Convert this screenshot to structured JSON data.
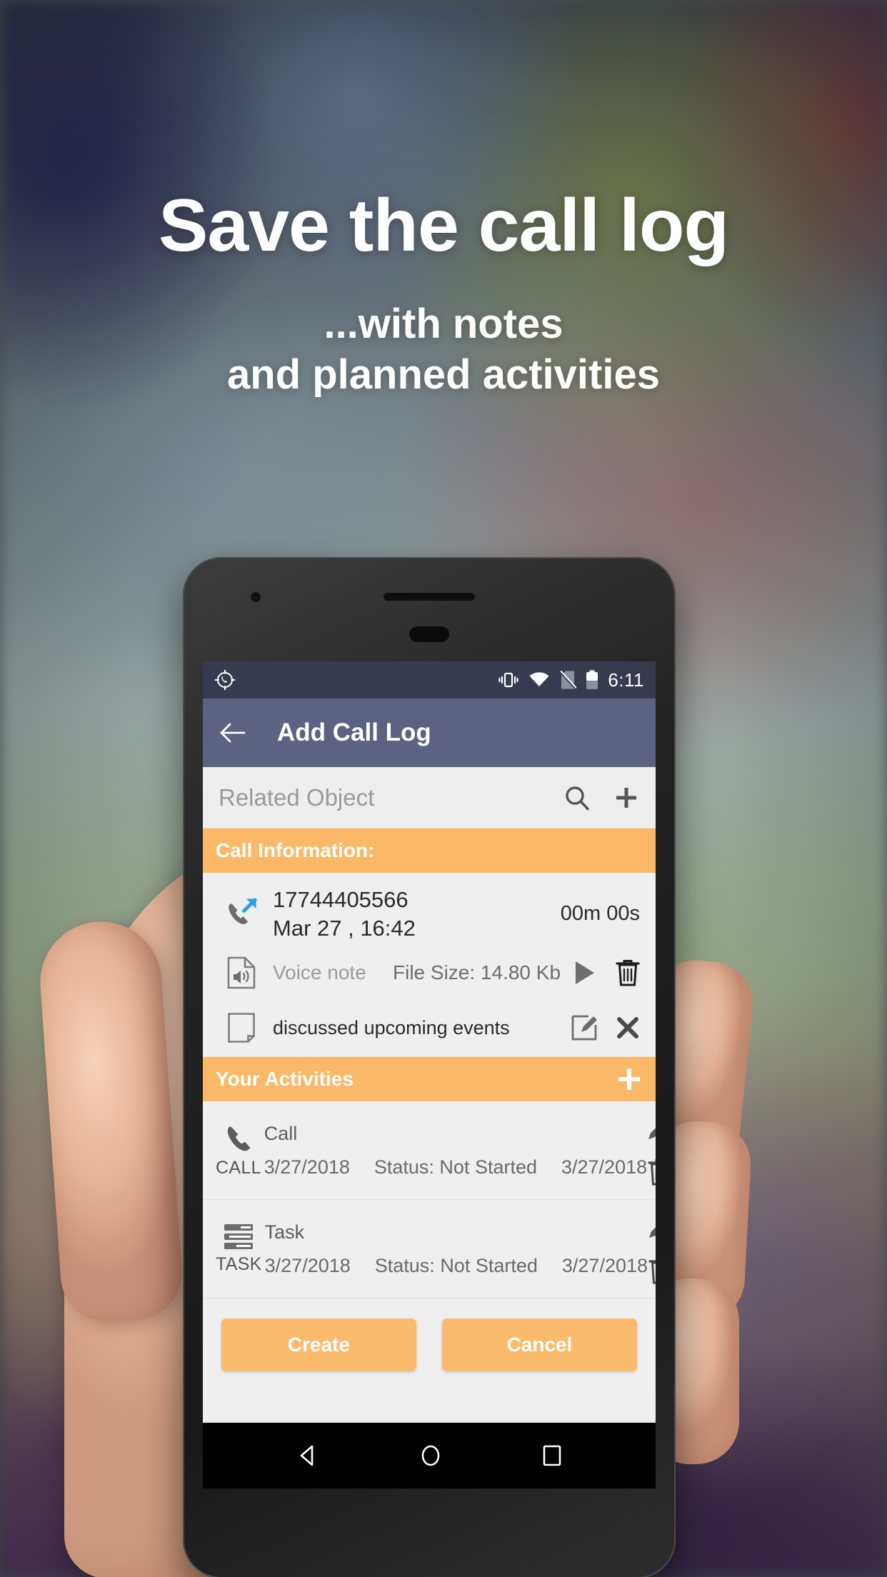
{
  "promo": {
    "headline": "Save the call log",
    "subhead_line1": "...with notes",
    "subhead_line2": "and planned activities"
  },
  "colors": {
    "accent_orange": "#FBB968",
    "app_bar": "#5D6182",
    "status_bar": "#373B4F",
    "button": "#FBBB6D",
    "screen_bg": "#EFEFEF",
    "call_arrow_blue": "#29A3DC"
  },
  "phone": {
    "status_bar": {
      "app_icon": "call-target-icon",
      "icons": [
        "vibrate-icon",
        "wifi-icon",
        "no-sim-icon",
        "battery-icon"
      ],
      "time": "6:11"
    },
    "app_bar": {
      "back_icon": "back-arrow-icon",
      "title": "Add Call Log"
    },
    "related_object": {
      "placeholder": "Related Object",
      "value": "",
      "search_icon": "search-icon",
      "add_icon": "plus-icon"
    },
    "call_information": {
      "header": "Call Information:",
      "call": {
        "icon": "outgoing-call-icon",
        "number": "17744405566",
        "datetime": "Mar 27 , 16:42",
        "duration": "00m 00s"
      },
      "voice_note": {
        "icon": "audio-file-icon",
        "label": "Voice note",
        "file_size": "File Size: 14.80 Kb",
        "play_icon": "play-icon",
        "delete_icon": "trash-icon"
      },
      "note": {
        "icon": "note-file-icon",
        "text": "discussed upcoming events",
        "edit_icon": "edit-note-icon",
        "remove_icon": "close-x-icon"
      }
    },
    "your_activities": {
      "header": "Your Activities",
      "add_icon": "plus-icon",
      "items": [
        {
          "icon": "phone-icon",
          "type_label": "CALL",
          "title": "Call",
          "start_date": "3/27/2018",
          "status": "Status: Not Started",
          "end_date": "3/27/2018",
          "edit_icon": "pencil-icon",
          "delete_icon": "trash-icon"
        },
        {
          "icon": "task-list-icon",
          "type_label": "TASK",
          "title": "Task",
          "start_date": "3/27/2018",
          "status": "Status: Not Started",
          "end_date": "3/27/2018",
          "edit_icon": "pencil-icon",
          "delete_icon": "trash-icon"
        }
      ]
    },
    "actions": {
      "create_label": "Create",
      "cancel_label": "Cancel"
    },
    "nav_bar": {
      "back": "nav-back-icon",
      "home": "nav-home-icon",
      "recents": "nav-recents-icon"
    }
  }
}
